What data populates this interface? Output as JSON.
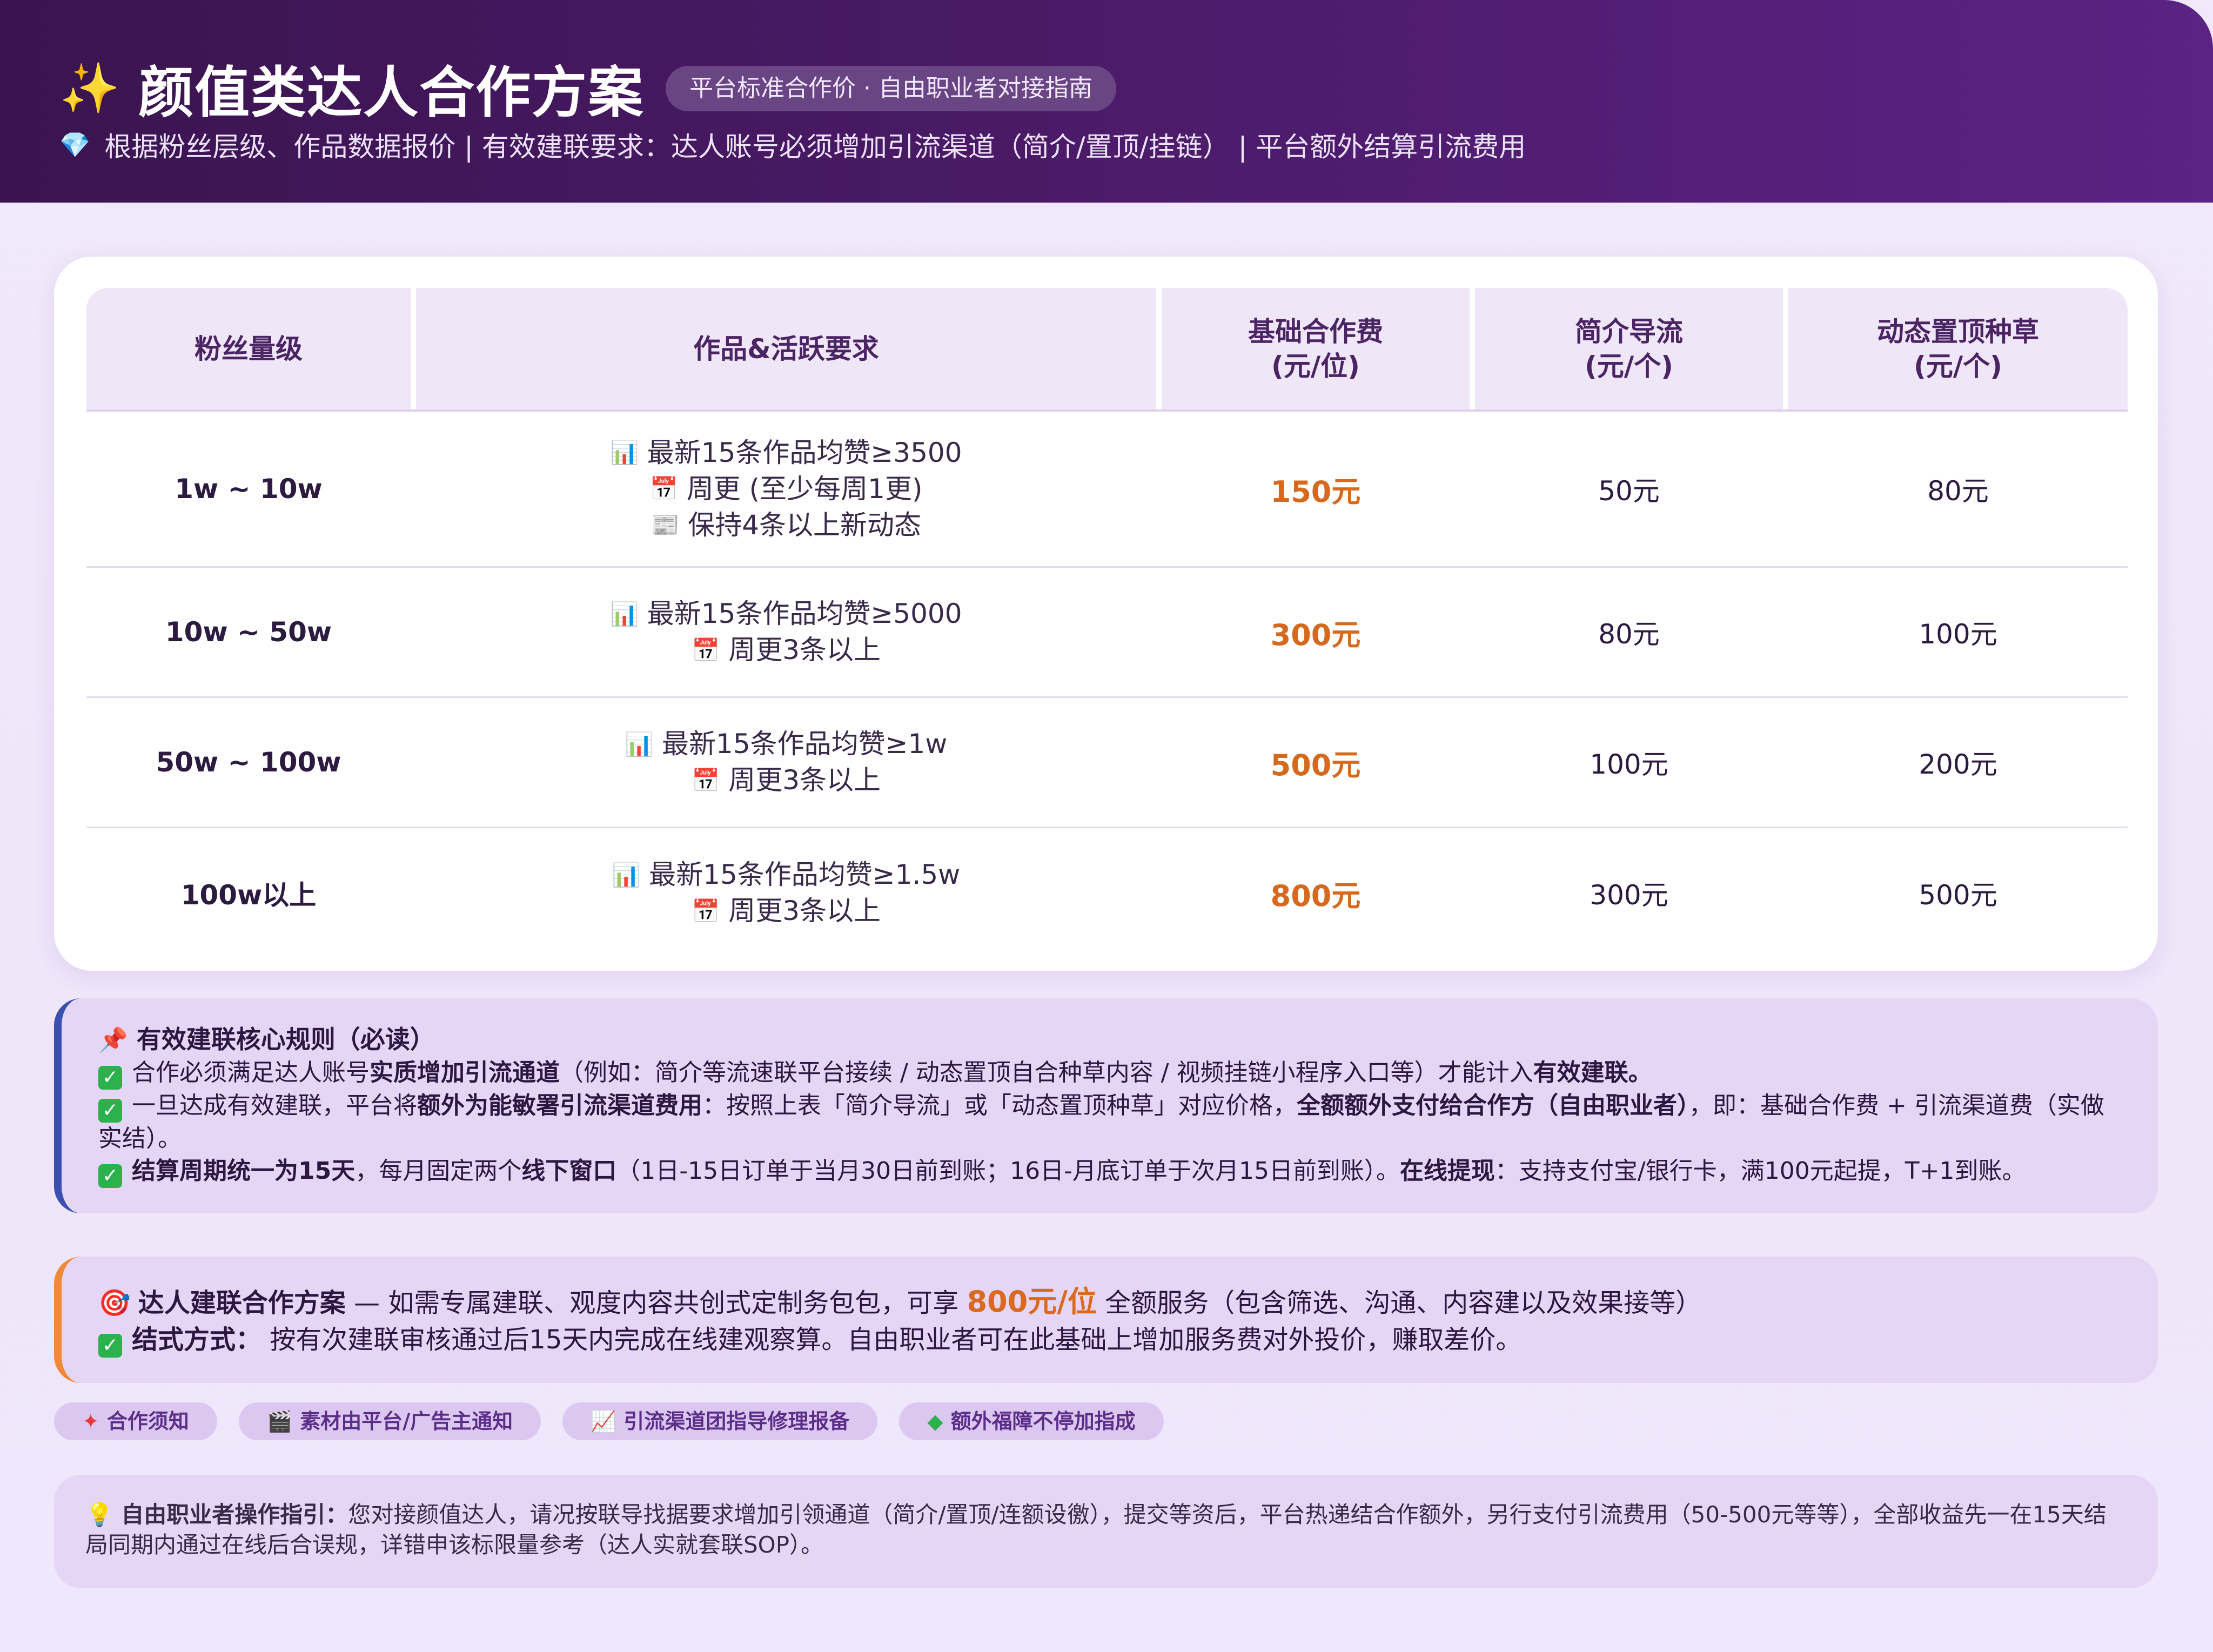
{
  "header": {
    "title": "颜值类达人合作方案",
    "badge": "平台标准合作价 · 自由职业者对接指南",
    "subtitle": "根据粉丝层级、作品数据报价 | 有效建联要求：达人账号必须增加引流渠道（简介/置顶/挂链） | 平台额外结算引流费用",
    "title_icon": "sparkles-icon",
    "subtitle_icon": "gem-icon"
  },
  "table": {
    "columns": [
      {
        "label": "粉丝量级"
      },
      {
        "label": "作品&活跃要求"
      },
      {
        "label": "基础合作费\n(元/位)"
      },
      {
        "label": "简介导流\n(元/个)"
      },
      {
        "label": "动态置顶种草\n(元/个)"
      }
    ],
    "rows": [
      {
        "tier": "1w ~ 10w",
        "reqs": [
          {
            "icon": "bar-chart-icon",
            "text": "最新15条作品均赞≥3500"
          },
          {
            "icon": "calendar-icon",
            "text": "周更 (至少每周1更)"
          },
          {
            "icon": "document-icon",
            "text": "保持4条以上新动态"
          }
        ],
        "fee": "150元",
        "bio": "50元",
        "pin": "80元"
      },
      {
        "tier": "10w ~ 50w",
        "reqs": [
          {
            "icon": "bar-chart-icon",
            "text": "最新15条作品均赞≥5000"
          },
          {
            "icon": "calendar-icon",
            "text": "周更3条以上"
          }
        ],
        "fee": "300元",
        "bio": "80元",
        "pin": "100元"
      },
      {
        "tier": "50w ~ 100w",
        "reqs": [
          {
            "icon": "bar-chart-icon",
            "text": "最新15条作品均赞≥1w"
          },
          {
            "icon": "calendar-icon",
            "text": "周更3条以上"
          }
        ],
        "fee": "500元",
        "bio": "100元",
        "pin": "200元"
      },
      {
        "tier": "100w以上",
        "reqs": [
          {
            "icon": "bar-chart-icon",
            "text": "最新15条作品均赞≥1.5w"
          },
          {
            "icon": "calendar-icon",
            "text": "周更3条以上"
          }
        ],
        "fee": "800元",
        "bio": "300元",
        "pin": "500元"
      }
    ]
  },
  "rules": {
    "title": "有效建联核心规则（必读）",
    "items": [
      {
        "bold_a": "",
        "text_a": "合作必须满足达人账号",
        "bold_b": "实质增加引流通道",
        "text_b": "（例如：简介等流速联平台接续 / 动态置顶自合种草内容 / 视频挂链小程序入口等）才能计入",
        "bold_c": "有效建联。",
        "text_c": ""
      },
      {
        "bold_a": "",
        "text_a": "一旦达成有效建联，平台将",
        "bold_b": "额外为能敏署引流渠道费用",
        "text_b": "：按照上表「简介导流」或「动态置顶种草」对应价格，",
        "bold_c": "全额额外支付给合作方（自由职业者）",
        "text_c": "，即：基础合作费 + 引流渠道费（实做实结）。"
      },
      {
        "bold_a": "结算周期统一为15天",
        "text_a": "，每月固定两个",
        "bold_b": "线下窗口",
        "text_b": "（1日-15日订单于当月30日前到账；16日-月底订单于次月15日前到账）。",
        "bold_c": "在线提现",
        "text_c": "：支持支付宝/银行卡，满100元起提，T+1到账。"
      }
    ]
  },
  "plan": {
    "line1_title": "达人建联合作方案",
    "line1_a": " — 如需专属建联、观度内容共创式定制务包包，可享 ",
    "line1_price": "800元/位",
    "line1_b": " 全额服务（包含筛选、沟通、内容建以及效果接等）",
    "line2_title": "结式方式：",
    "line2_text": " 按有次建联审核通过后15天内完成在线建观察算。自由职业者可在此基础上增加服务费对外投价，赚取差价。"
  },
  "tags": [
    {
      "icon": "star-icon",
      "glyph": "✦",
      "label": "合作须知"
    },
    {
      "icon": "clapper-icon",
      "glyph": "🎬",
      "label": "素材由平台/广告主通知"
    },
    {
      "icon": "trend-icon",
      "glyph": "📈",
      "label": "引流渠道团指导修理报备"
    },
    {
      "icon": "diamond-icon",
      "glyph": "◆",
      "label": "额外福障不停加指成"
    }
  ],
  "guide": {
    "title": "自由职业者操作指引：",
    "text": "您对接颜值达人，请况按联导找据要求增加引领通道（简介/置顶/连额设徼），提交等资后，平台热递结合作额外，另行支付引流费用（50-500元等等），全部收益先一在15天结局同期内通过在线后合误规，详错申该标限量参考（达人实就套联SOP）。"
  }
}
